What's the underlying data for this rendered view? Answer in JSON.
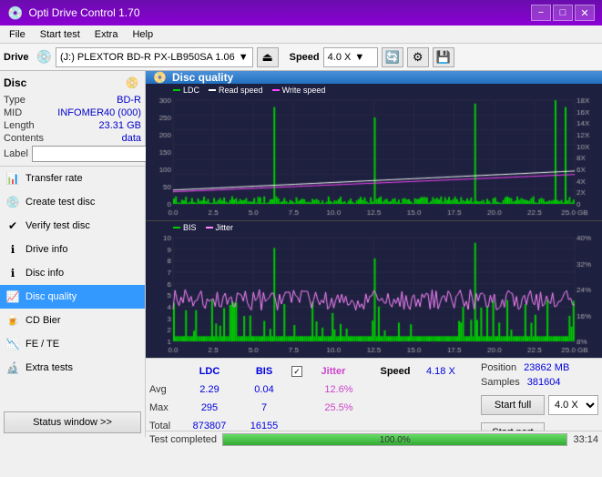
{
  "titleBar": {
    "title": "Opti Drive Control 1.70",
    "minimize": "−",
    "maximize": "□",
    "close": "✕"
  },
  "menuBar": {
    "items": [
      "File",
      "Start test",
      "Extra",
      "Help"
    ]
  },
  "toolbar": {
    "driveLabel": "Drive",
    "driveName": "(J:)  PLEXTOR BD-R  PX-LB950SA 1.06",
    "speedLabel": "Speed",
    "speedValue": "4.0 X"
  },
  "sidebar": {
    "disc": {
      "title": "Disc",
      "typeLabel": "Type",
      "typeValue": "BD-R",
      "midLabel": "MID",
      "midValue": "INFOMER40 (000)",
      "lengthLabel": "Length",
      "lengthValue": "23.31 GB",
      "contentsLabel": "Contents",
      "contentsValue": "data",
      "labelLabel": "Label",
      "labelValue": ""
    },
    "navItems": [
      {
        "id": "transfer-rate",
        "label": "Transfer rate",
        "active": false
      },
      {
        "id": "create-test-disc",
        "label": "Create test disc",
        "active": false
      },
      {
        "id": "verify-test-disc",
        "label": "Verify test disc",
        "active": false
      },
      {
        "id": "drive-info",
        "label": "Drive info",
        "active": false
      },
      {
        "id": "disc-info",
        "label": "Disc info",
        "active": false
      },
      {
        "id": "disc-quality",
        "label": "Disc quality",
        "active": true
      },
      {
        "id": "cd-bier",
        "label": "CD Bier",
        "active": false
      },
      {
        "id": "fe-te",
        "label": "FE / TE",
        "active": false
      },
      {
        "id": "extra-tests",
        "label": "Extra tests",
        "active": false
      }
    ],
    "statusBtn": "Status window >>"
  },
  "discQuality": {
    "title": "Disc quality",
    "legend": [
      {
        "label": "LDC",
        "color": "#00aa00"
      },
      {
        "label": "Read speed",
        "color": "#ffffff"
      },
      {
        "label": "Write speed",
        "color": "#ff44ff"
      }
    ],
    "legend2": [
      {
        "label": "BIS",
        "color": "#00aa00"
      },
      {
        "label": "Jitter",
        "color": "#ff88ff"
      }
    ]
  },
  "stats": {
    "headers": [
      "LDC",
      "BIS",
      "Jitter",
      "Speed",
      ""
    ],
    "avg": {
      "ldc": "2.29",
      "bis": "0.04",
      "jitter": "12.6%"
    },
    "max": {
      "ldc": "295",
      "bis": "7",
      "jitter": "25.5%"
    },
    "total": {
      "ldc": "873807",
      "bis": "16155"
    },
    "speed": {
      "value": "4.18 X"
    },
    "speedDropdown": "4.0 X",
    "position": {
      "label": "Position",
      "value": "23862 MB"
    },
    "samples": {
      "label": "Samples",
      "value": "381604"
    },
    "buttons": {
      "startFull": "Start full",
      "startPart": "Start part"
    }
  },
  "progressBar": {
    "percent": 100,
    "percentText": "100.0%",
    "statusText": "Test completed",
    "time": "33:14"
  }
}
